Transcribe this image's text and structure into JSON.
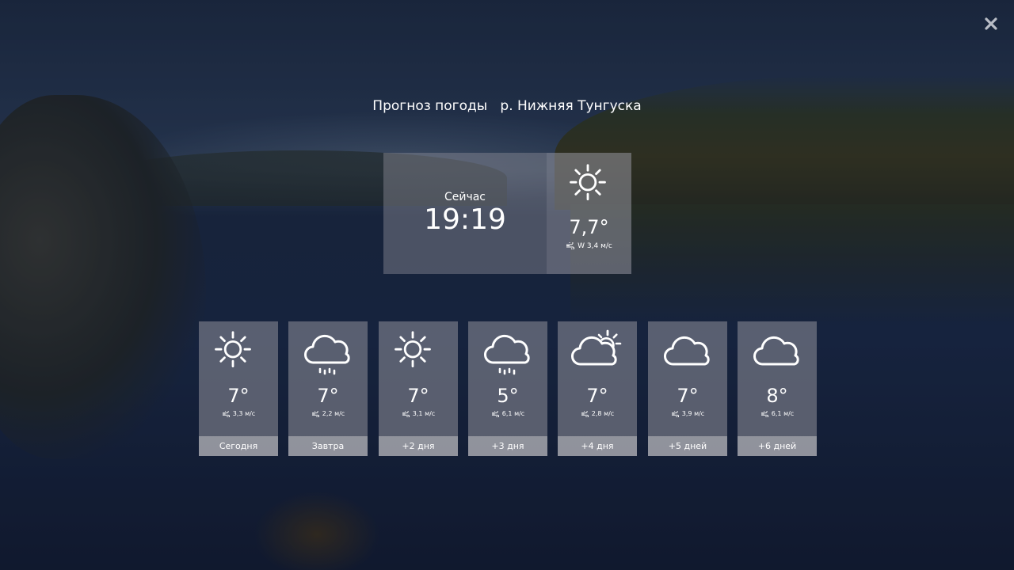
{
  "header": {
    "title": "Прогноз погоды   р. Нижняя Тунгуска"
  },
  "close": {
    "icon": "close-icon"
  },
  "current": {
    "label": "Сейчас",
    "time": "19:19",
    "icon": "sun-icon",
    "temperature": "7,7°",
    "wind": "W  3,4 м/с"
  },
  "forecast": [
    {
      "icon": "sun-icon",
      "temp": "7°",
      "wind": "3,3 м/с",
      "label": "Сегодня"
    },
    {
      "icon": "cloud-rain-icon",
      "temp": "7°",
      "wind": "2,2 м/с",
      "label": "Завтра"
    },
    {
      "icon": "sun-icon",
      "temp": "7°",
      "wind": "3,1 м/с",
      "label": "+2 дня"
    },
    {
      "icon": "cloud-rain-icon",
      "temp": "5°",
      "wind": "6,1 м/с",
      "label": "+3 дня"
    },
    {
      "icon": "cloud-sun-icon",
      "temp": "7°",
      "wind": "2,8 м/с",
      "label": "+4 дня"
    },
    {
      "icon": "cloud-icon",
      "temp": "7°",
      "wind": "3,9 м/с",
      "label": "+5 дней"
    },
    {
      "icon": "cloud-icon",
      "temp": "8°",
      "wind": "6,1 м/с",
      "label": "+6 дней"
    }
  ],
  "colors": {
    "panel": "#8c8c96",
    "text": "#ffffff"
  }
}
